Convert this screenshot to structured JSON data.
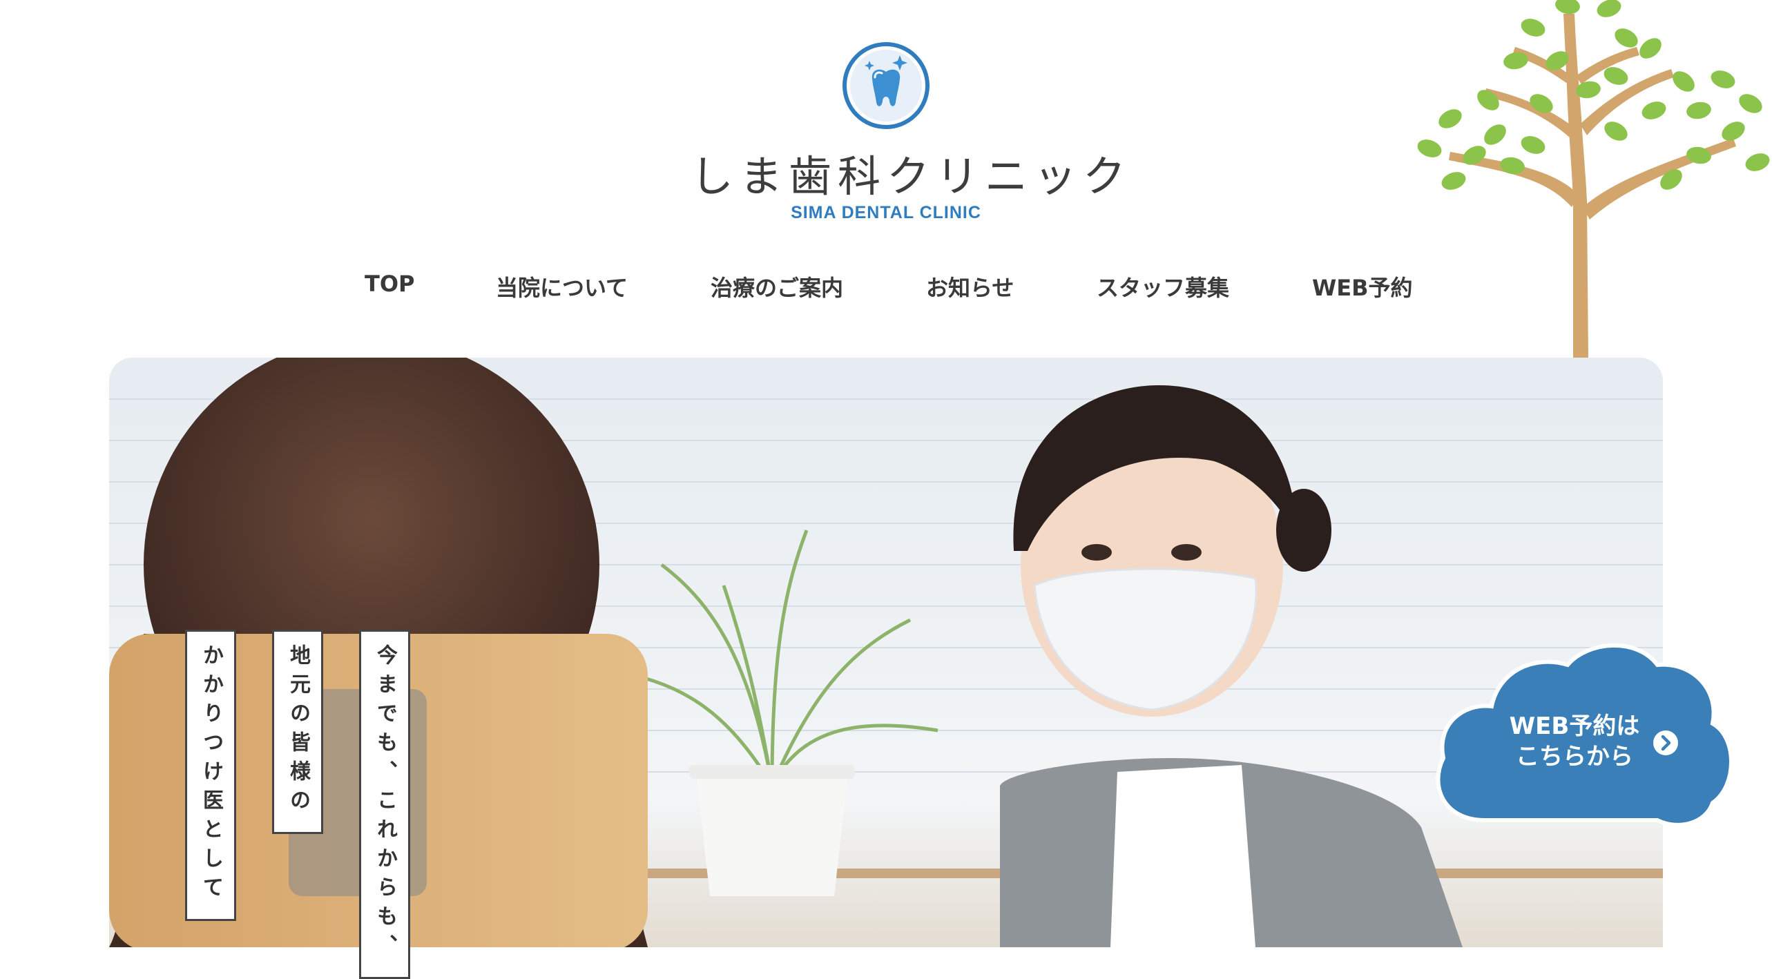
{
  "brand": {
    "logo_icon": "tooth-sparkle-icon",
    "name": "しま歯科クリニック",
    "subtitle": "SIMA DENTAL CLINIC",
    "accent_color": "#2f7cbe"
  },
  "nav": {
    "items": [
      {
        "label": "TOP"
      },
      {
        "label": "当院について"
      },
      {
        "label": "治療のご案内"
      },
      {
        "label": "お知らせ"
      },
      {
        "label": "スタッフ募集"
      },
      {
        "label": "WEB予約"
      }
    ]
  },
  "decoration": {
    "tree_icon": "tree-illustration",
    "leaf_color": "#8cc34a",
    "trunk_color": "#d1a56b"
  },
  "hero": {
    "image": "dentist-consultation-photo",
    "catch_lines": [
      "今までも、これからも、",
      "地元の皆様の",
      "かかりつけ医として"
    ]
  },
  "reserve_button": {
    "line1": "WEB予約は",
    "line2": "こちらから",
    "icon": "chevron-right-circle-icon",
    "color": "#3b7fb8"
  }
}
